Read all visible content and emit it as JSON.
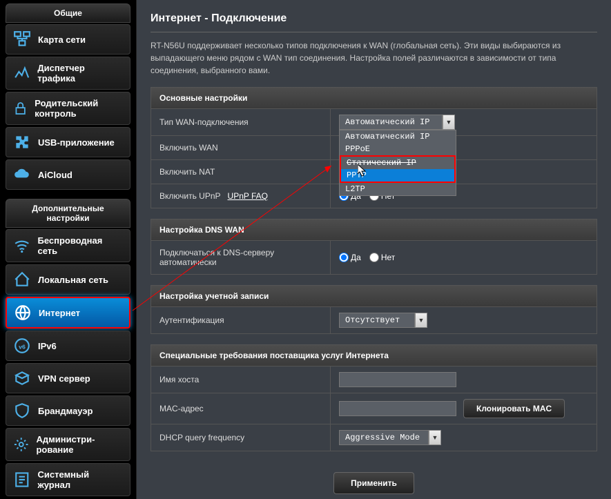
{
  "sidebar": {
    "general_header": "Общие",
    "advanced_header": "Дополнительные настройки",
    "general_items": [
      {
        "label": "Карта сети",
        "icon": "network-map"
      },
      {
        "label": "Диспетчер трафика",
        "icon": "traffic"
      },
      {
        "label": "Родительский контроль",
        "icon": "lock"
      },
      {
        "label": "USB-приложение",
        "icon": "puzzle"
      },
      {
        "label": "AiCloud",
        "icon": "cloud"
      }
    ],
    "advanced_items": [
      {
        "label": "Беспроводная сеть",
        "icon": "wifi"
      },
      {
        "label": "Локальная сеть",
        "icon": "home"
      },
      {
        "label": "Интернет",
        "icon": "globe",
        "active": true
      },
      {
        "label": "IPv6",
        "icon": "ipv6"
      },
      {
        "label": "VPN сервер",
        "icon": "vpn"
      },
      {
        "label": "Брандмауэр",
        "icon": "shield"
      },
      {
        "label": "Администри-рование",
        "icon": "gear"
      },
      {
        "label": "Системный журнал",
        "icon": "log"
      }
    ]
  },
  "main": {
    "title": "Интернет - Подключение",
    "description": "RT-N56U поддерживает несколько типов подключения к WAN (глобальная сеть). Эти виды выбираются из выпадающего меню рядом с WAN тип соединения. Настройка полей различаются в зависимости от типа соединения, выбранного вами.",
    "sections": {
      "basic": {
        "header": "Основные настройки",
        "wan_type_label": "Тип WAN-подключения",
        "wan_type_value": "Автоматический IP",
        "wan_options": [
          "Автоматический IP",
          "PPPoE",
          "Статический IP",
          "PPTP",
          "L2TP"
        ],
        "selected_option": "PPTP",
        "enable_wan_label": "Включить WAN",
        "enable_nat_label": "Включить NAT",
        "enable_upnp_label": "Включить UPnP",
        "upnp_faq": "UPnP  FAQ",
        "yes": "Да",
        "no": "Нет"
      },
      "dns": {
        "header": "Настройка DNS WAN",
        "auto_dns_label": "Подключаться к DNS-серверу автоматически"
      },
      "account": {
        "header": "Настройка учетной записи",
        "auth_label": "Аутентификация",
        "auth_value": "Отсутствует"
      },
      "isp": {
        "header": "Специальные требования поставщика услуг Интернета",
        "hostname_label": "Имя хоста",
        "hostname_value": "",
        "mac_label": "MAC-адрес",
        "mac_value": "",
        "clone_mac": "Клонировать MAC",
        "dhcp_label": "DHCP query frequency",
        "dhcp_value": "Aggressive Mode"
      },
      "submit": "Применить"
    }
  }
}
